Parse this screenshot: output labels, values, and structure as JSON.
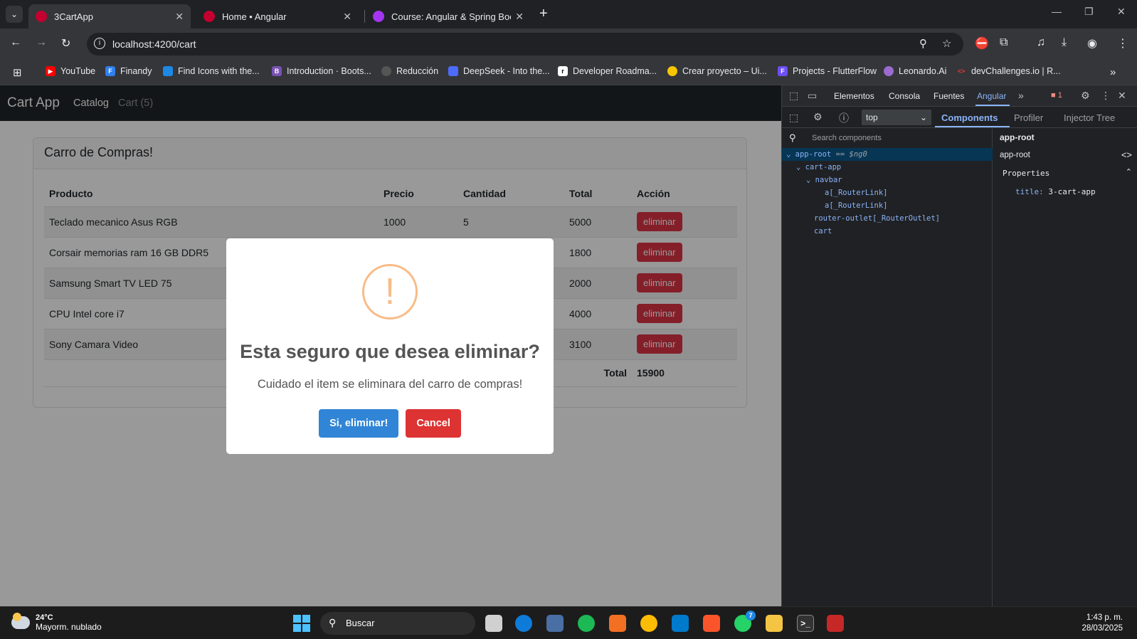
{
  "browser": {
    "tabs": [
      {
        "label": "3CartApp",
        "active": true
      },
      {
        "label": "Home • Angular",
        "active": false
      },
      {
        "label": "Course: Angular & Spring Boot",
        "active": false
      }
    ],
    "url": "localhost:4200/cart",
    "bookmarks": [
      "YouTube",
      "Finandy",
      "Find Icons with the...",
      "Introduction · Boots...",
      "Reducción",
      "DeepSeek - Into the...",
      "Developer Roadma...",
      "Crear proyecto – Ui...",
      "Projects - FlutterFlow",
      "Leonardo.Ai",
      "devChallenges.io | R..."
    ]
  },
  "app": {
    "brand": "Cart App",
    "nav": {
      "catalog": "Catalog",
      "cart": "Cart (5)"
    },
    "card_title": "Carro de Compras!",
    "table": {
      "headers": [
        "Producto",
        "Precio",
        "Cantidad",
        "Total",
        "Acción"
      ],
      "rows": [
        {
          "product": "Teclado mecanico Asus RGB",
          "price": "1000",
          "qty": "5",
          "total": "5000"
        },
        {
          "product": "Corsair memorias ram 16 GB DDR5",
          "price": "",
          "qty": "",
          "total": "1800"
        },
        {
          "product": "Samsung Smart TV LED 75",
          "price": "",
          "qty": "",
          "total": "2000"
        },
        {
          "product": "CPU Intel core i7",
          "price": "",
          "qty": "",
          "total": "4000"
        },
        {
          "product": "Sony Camara Video",
          "price": "",
          "qty": "",
          "total": "3100"
        }
      ],
      "delete_label": "eliminar",
      "total_label": "Total",
      "grand_total": "15900"
    }
  },
  "modal": {
    "icon": "!",
    "title": "Esta seguro que desea eliminar?",
    "text": "Cuidado el item se eliminara del carro de compras!",
    "confirm": "Si, eliminar!",
    "cancel": "Cancel"
  },
  "devtools": {
    "tabs": [
      "Elementos",
      "Consola",
      "Fuentes",
      "Angular"
    ],
    "error_count": "1",
    "context": "top",
    "angular_tabs": [
      "Components",
      "Profiler",
      "Injector Tree"
    ],
    "search_placeholder": "Search components",
    "tree": {
      "root": "app-root",
      "root_hint": "== $ng0",
      "cart_app": "cart-app",
      "navbar": "navbar",
      "link1": "a[_RouterLink]",
      "link2": "a[_RouterLink]",
      "outlet": "router-outlet[_RouterOutlet]",
      "cart": "cart"
    },
    "footer": "app-root",
    "props": {
      "header": "app-root",
      "component": "app-root",
      "section": "Properties",
      "key": "title:",
      "value": "3-cart-app"
    }
  },
  "taskbar": {
    "temp": "24°C",
    "weather": "Mayorm. nublado",
    "search": "Buscar",
    "whatsapp_badge": "7",
    "time": "1:43 p. m.",
    "date": "28/03/2025"
  }
}
